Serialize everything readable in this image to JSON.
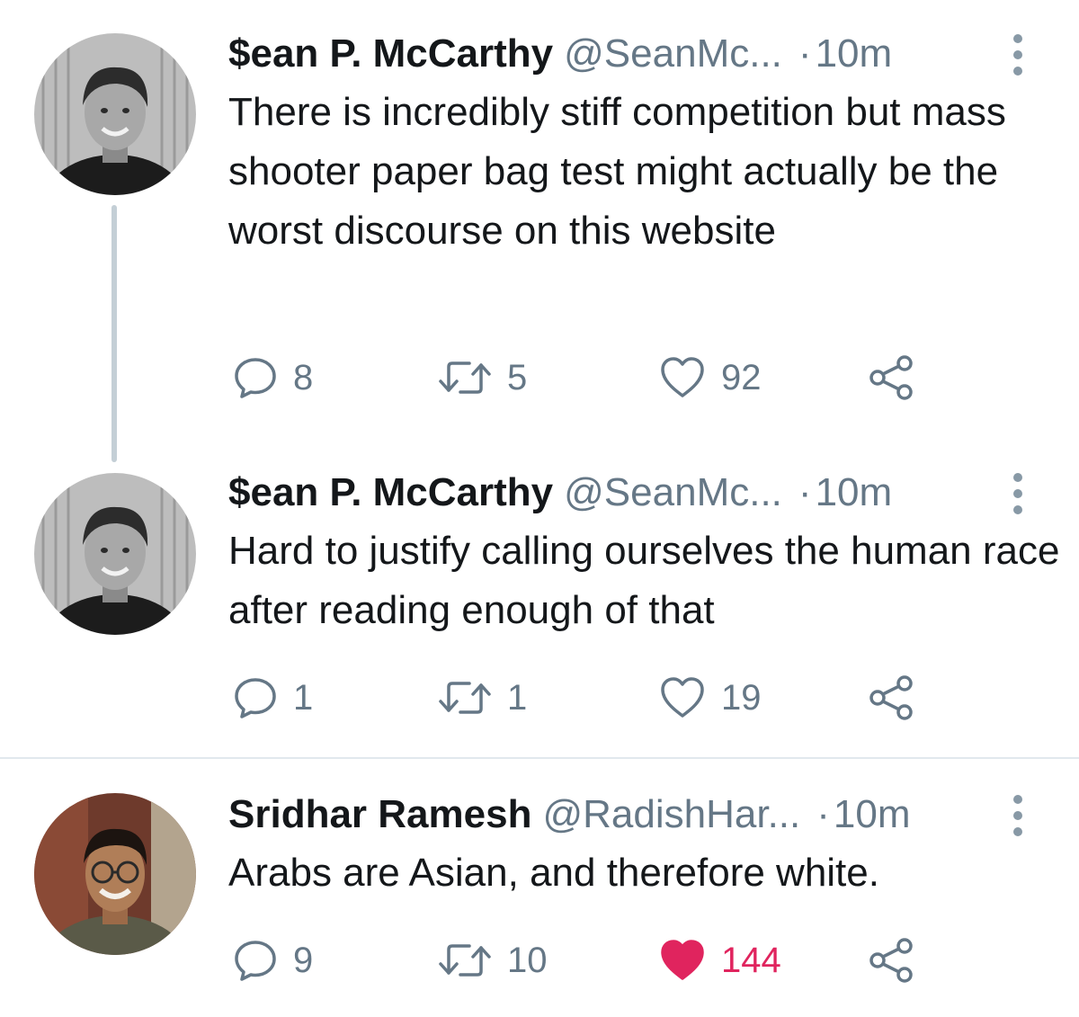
{
  "colors": {
    "text": "#14171a",
    "secondary": "#657786",
    "like_active": "#e0245e",
    "thread_line": "#c4cfd6",
    "divider": "#e1e8ed"
  },
  "tweets": [
    {
      "name": "$ean P. McCarthy",
      "handle": "@SeanMc...",
      "dot": "·",
      "time": "10m",
      "text": "There is incredibly stiff competition but mass shooter paper bag test might actually be the worst discourse on this website",
      "replies": "8",
      "retweets": "5",
      "likes": "92",
      "liked": false
    },
    {
      "name": "$ean P. McCarthy",
      "handle": "@SeanMc...",
      "dot": "·",
      "time": "10m",
      "text": "Hard to justify calling ourselves the human race after reading enough of that",
      "replies": "1",
      "retweets": "1",
      "likes": "19",
      "liked": false
    },
    {
      "name": "Sridhar Ramesh",
      "handle": "@RadishHar...",
      "dot": "·",
      "time": "10m",
      "text": "Arabs are Asian, and therefore white.",
      "replies": "9",
      "retweets": "10",
      "likes": "144",
      "liked": true
    }
  ],
  "icons": {
    "reply": "reply-icon",
    "retweet": "retweet-icon",
    "like": "heart-icon",
    "share": "share-icon",
    "more": "more-vertical-icon"
  }
}
